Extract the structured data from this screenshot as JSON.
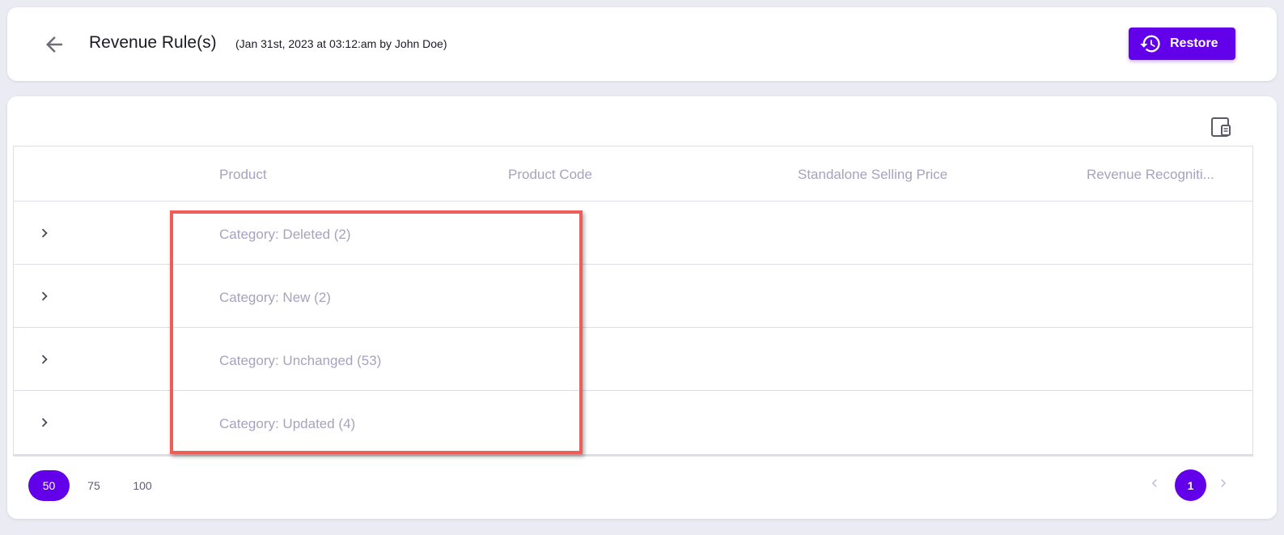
{
  "header": {
    "title": "Revenue Rule(s)",
    "subtitle": "(Jan 31st, 2023 at 03:12:am by John Doe)",
    "back_icon": "arrow-left-icon",
    "restore_label": "Restore",
    "restore_icon": "history-icon"
  },
  "toolbar": {
    "columns_icon": "column-panel-icon"
  },
  "grid": {
    "columns": [
      "Product",
      "Product Code",
      "Standalone Selling Price",
      "Revenue Recogniti..."
    ],
    "rows": [
      {
        "label": "Category: Deleted (2)"
      },
      {
        "label": "Category: New (2)"
      },
      {
        "label": "Category: Unchanged (53)"
      },
      {
        "label": "Category: Updated (4)"
      }
    ],
    "expand_icon": "chevron-right-icon"
  },
  "pagination": {
    "page_sizes": [
      "50",
      "75",
      "100"
    ],
    "active_page_size": "50",
    "current_page": "1"
  },
  "colors": {
    "accent": "#6200ea",
    "highlight": "#ef5e56",
    "muted_text": "#a6a3bd",
    "background": "#ebebf4"
  }
}
